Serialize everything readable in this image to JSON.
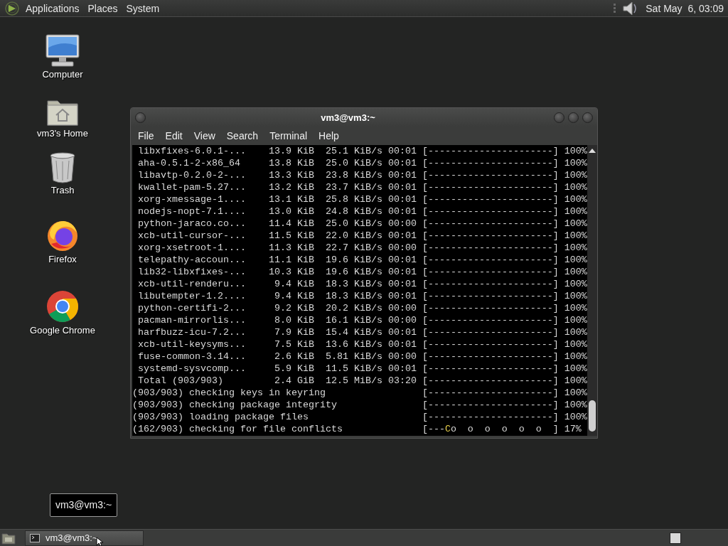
{
  "top_panel": {
    "menus": [
      "Applications",
      "Places",
      "System"
    ],
    "clock": "Sat May  6, 03:09"
  },
  "desktop_icons": [
    {
      "kind": "computer",
      "label": "Computer"
    },
    {
      "kind": "home",
      "label": "vm3's Home"
    },
    {
      "kind": "trash",
      "label": "Trash"
    },
    {
      "kind": "firefox",
      "label": "Firefox"
    },
    {
      "kind": "chrome",
      "label": "Google Chrome"
    }
  ],
  "terminal": {
    "title": "vm3@vm3:~",
    "menu": [
      "File",
      "Edit",
      "View",
      "Search",
      "Terminal",
      "Help"
    ],
    "lines": [
      {
        "kind": "text",
        "text": " libxfixes-6.0.1-...    13.9 KiB  25.1 KiB/s 00:01 [----------------------] 100%"
      },
      {
        "kind": "text",
        "text": " aha-0.5.1-2-x86_64     13.8 KiB  25.0 KiB/s 00:01 [----------------------] 100%"
      },
      {
        "kind": "text",
        "text": " libavtp-0.2.0-2-...    13.3 KiB  23.8 KiB/s 00:01 [----------------------] 100%"
      },
      {
        "kind": "text",
        "text": " kwallet-pam-5.27...    13.2 KiB  23.7 KiB/s 00:01 [----------------------] 100%"
      },
      {
        "kind": "text",
        "text": " xorg-xmessage-1....    13.1 KiB  25.8 KiB/s 00:01 [----------------------] 100%"
      },
      {
        "kind": "text",
        "text": " nodejs-nopt-7.1....    13.0 KiB  24.8 KiB/s 00:01 [----------------------] 100%"
      },
      {
        "kind": "text",
        "text": " python-jaraco.co...    11.4 KiB  25.0 KiB/s 00:00 [----------------------] 100%"
      },
      {
        "kind": "text",
        "text": " xcb-util-cursor-...    11.5 KiB  22.0 KiB/s 00:01 [----------------------] 100%"
      },
      {
        "kind": "text",
        "text": " xorg-xsetroot-1....    11.3 KiB  22.7 KiB/s 00:00 [----------------------] 100%"
      },
      {
        "kind": "text",
        "text": " telepathy-accoun...    11.1 KiB  19.6 KiB/s 00:01 [----------------------] 100%"
      },
      {
        "kind": "text",
        "text": " lib32-libxfixes-...    10.3 KiB  19.6 KiB/s 00:01 [----------------------] 100%"
      },
      {
        "kind": "text",
        "text": " xcb-util-renderu...     9.4 KiB  18.3 KiB/s 00:01 [----------------------] 100%"
      },
      {
        "kind": "text",
        "text": " libutempter-1.2....     9.4 KiB  18.3 KiB/s 00:01 [----------------------] 100%"
      },
      {
        "kind": "text",
        "text": " python-certifi-2...     9.2 KiB  20.2 KiB/s 00:00 [----------------------] 100%"
      },
      {
        "kind": "text",
        "text": " pacman-mirrorlis...     8.0 KiB  16.1 KiB/s 00:00 [----------------------] 100%"
      },
      {
        "kind": "text",
        "text": " harfbuzz-icu-7.2...     7.9 KiB  15.4 KiB/s 00:01 [----------------------] 100%"
      },
      {
        "kind": "text",
        "text": " xcb-util-keysyms...     7.5 KiB  13.6 KiB/s 00:01 [----------------------] 100%"
      },
      {
        "kind": "text",
        "text": " fuse-common-3.14...     2.6 KiB  5.81 KiB/s 00:00 [----------------------] 100%"
      },
      {
        "kind": "text",
        "text": " systemd-sysvcomp...     5.9 KiB  11.5 KiB/s 00:01 [----------------------] 100%"
      },
      {
        "kind": "text",
        "text": " Total (903/903)         2.4 GiB  12.5 MiB/s 03:20 [----------------------] 100%"
      },
      {
        "kind": "text",
        "text": "(903/903) checking keys in keyring                 [----------------------] 100%"
      },
      {
        "kind": "text",
        "text": "(903/903) checking package integrity               [----------------------] 100%"
      },
      {
        "kind": "text",
        "text": "(903/903) loading package files                    [----------------------] 100%"
      },
      {
        "kind": "pacman",
        "text": "(162/903) checking for file conflicts",
        "bar_start": "[---",
        "pacman": "C",
        "bar_end": "o  o  o  o  o  o  ]",
        "percent": "17%"
      }
    ]
  },
  "tooltip": "vm3@vm3:~",
  "taskbar": {
    "tasks": [
      "vm3@vm3:~"
    ]
  }
}
